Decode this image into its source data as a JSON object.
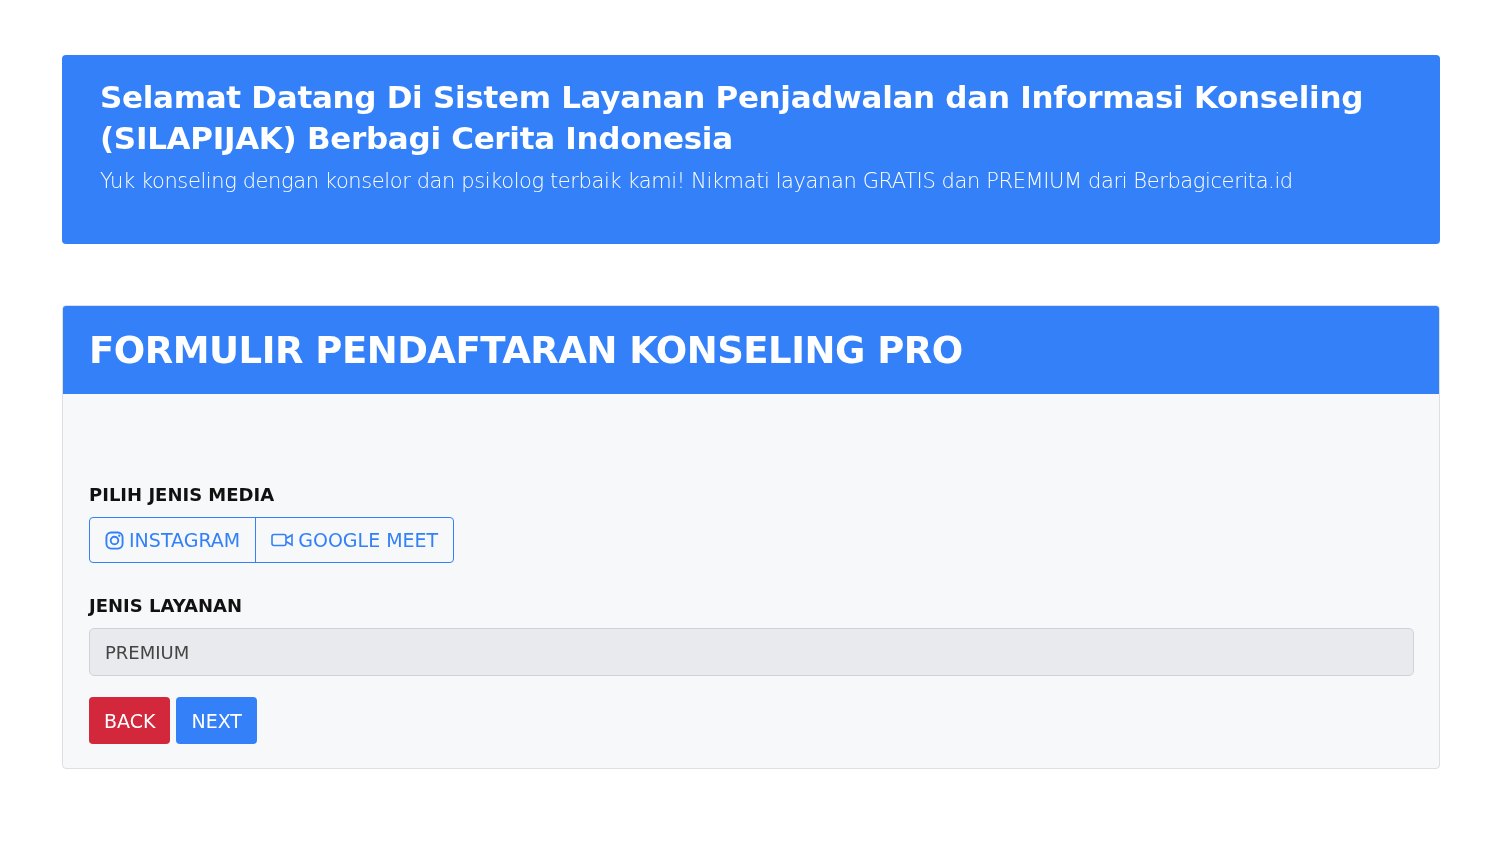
{
  "banner": {
    "title": "Selamat Datang Di Sistem Layanan Penjadwalan dan Informasi Konseling (SILAPIJAK) Berbagi Cerita Indonesia",
    "subtitle": "Yuk konseling dengan konselor dan psikolog terbaik kami! Nikmati layanan GRATIS dan PREMIUM dari Berbagicerita.id"
  },
  "form": {
    "title": "FORMULIR PENDAFTARAN KONSELING PRO",
    "media_label": "PILIH JENIS MEDIA",
    "media_options": [
      {
        "kind": "instagram",
        "label": "INSTAGRAM",
        "selected": false
      },
      {
        "kind": "video",
        "label": "GOOGLE MEET",
        "selected": false
      }
    ],
    "service_label": "JENIS LAYANAN",
    "service_field": {
      "value": "PREMIUM",
      "disabled": true
    },
    "buttons": [
      {
        "kind": "danger",
        "label": "BACK"
      },
      {
        "kind": "primary",
        "label": "NEXT"
      }
    ]
  }
}
